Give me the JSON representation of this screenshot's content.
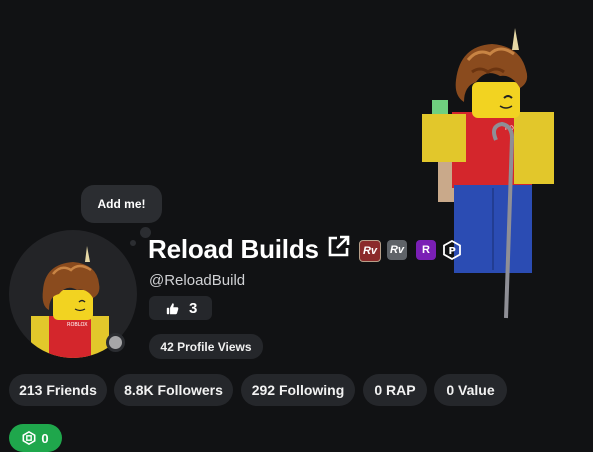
{
  "bubble": {
    "label": "Add me!"
  },
  "profile": {
    "display_name": "Reload Builds",
    "username": "@ReloadBuild",
    "likes": "3",
    "profile_views": "42 Profile Views",
    "status": "offline"
  },
  "badges": [
    {
      "icon": "rolimons-verified-icon",
      "text": "Rv",
      "color": "#8b2a2a"
    },
    {
      "icon": "rolimons-grey-icon",
      "text": "Rv",
      "color": "#5f6368"
    },
    {
      "icon": "purple-r-icon",
      "text": "R",
      "color": "#7a1fb5"
    },
    {
      "icon": "hexagon-p-icon",
      "text": "P",
      "color": "#111214"
    }
  ],
  "stats": [
    {
      "label": "213 Friends"
    },
    {
      "label": "8.8K Followers"
    },
    {
      "label": "292 Following"
    },
    {
      "label": "0 RAP"
    },
    {
      "label": "0 Value"
    }
  ],
  "currency": {
    "value": "0",
    "icon": "robux-icon",
    "color": "#1fa74c"
  },
  "colors": {
    "background": "#111214",
    "pill": "#25272b",
    "accent_green": "#1fa74c"
  }
}
